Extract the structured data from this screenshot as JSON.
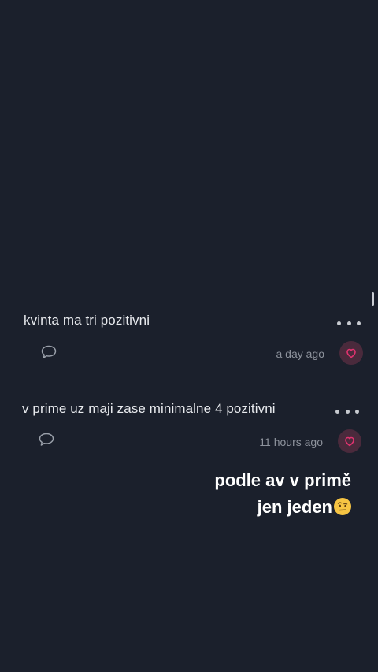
{
  "posts": [
    {
      "text": "kvinta ma tri pozitivni",
      "time": "a day ago",
      "more_icon": "more-dots-icon",
      "comment_icon": "comment-bubble-icon",
      "reaction_icon": "heart-reaction-icon"
    },
    {
      "text": "v prime uz maji zase minimalne 4 pozitivni",
      "time": "11 hours ago",
      "more_icon": "more-dots-icon",
      "comment_icon": "comment-bubble-icon",
      "reaction_icon": "heart-reaction-icon"
    }
  ],
  "caption": {
    "line1": "podle av v primě",
    "line2": "jen jeden",
    "emoji": "raised-eyebrow-emoji"
  },
  "colors": {
    "background": "#1b202c",
    "reaction_bg": "#4a2a3c",
    "reaction_accent": "#e0336f"
  }
}
